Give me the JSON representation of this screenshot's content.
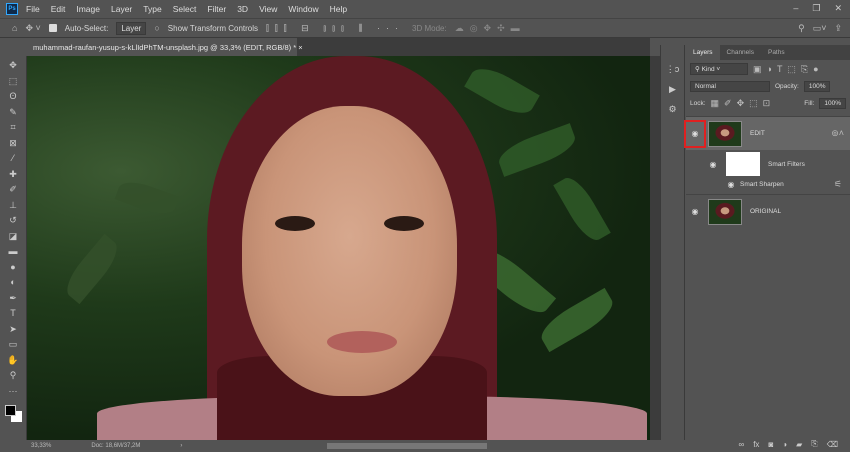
{
  "menu": {
    "logo": "Ps",
    "items": [
      "File",
      "Edit",
      "Image",
      "Layer",
      "Type",
      "Select",
      "Filter",
      "3D",
      "View",
      "Window",
      "Help"
    ]
  },
  "options": {
    "auto_select": "Auto-Select:",
    "layer_select": "Layer",
    "show_transform": "Show Transform Controls",
    "mode_3d": "3D Mode:"
  },
  "document": {
    "tab_title": "muhammad-raufan-yusup-s-kLlIdPhTM-unsplash.jpg @ 33,3% (EDIT, RGB/8) *",
    "close": "×"
  },
  "status": {
    "zoom": "33,33%",
    "doc": "Doc: 18,6M/37,2M"
  },
  "panel": {
    "tabs": [
      "Layers",
      "Channels",
      "Paths"
    ],
    "filter_kind": "Kind",
    "blend_mode": "Normal",
    "opacity_label": "Opacity:",
    "opacity": "100%",
    "lock_label": "Lock:",
    "fill_label": "Fill:",
    "fill": "100%",
    "layers": [
      {
        "name": "EDIT"
      },
      {
        "name": "Smart Filters"
      },
      {
        "name": "Smart Sharpen"
      },
      {
        "name": "ORIGINAL"
      }
    ]
  }
}
